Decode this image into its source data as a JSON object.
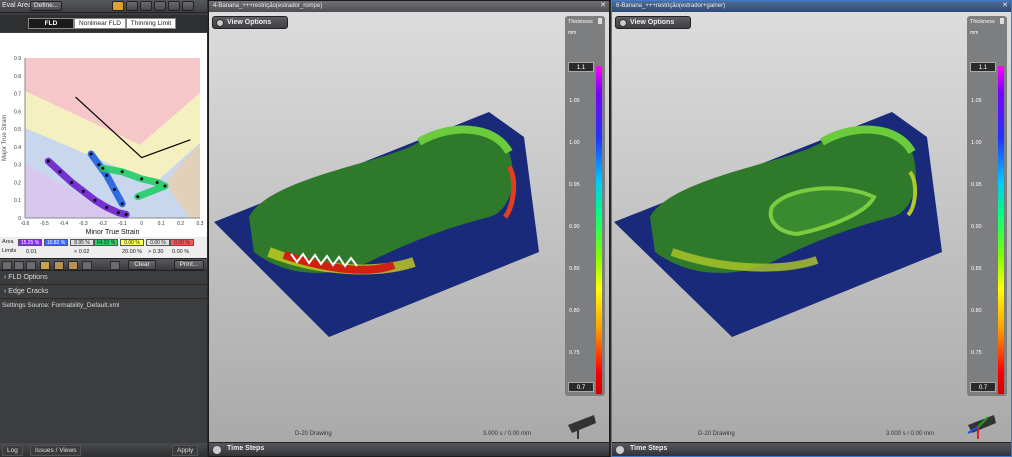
{
  "left": {
    "header": {
      "eval_area": "Eval Area",
      "define_btn": "Define..."
    },
    "tabs": [
      {
        "label": "FLD",
        "active": true
      },
      {
        "label": "Nonlinear FLD",
        "active": false
      },
      {
        "label": "Thinning Limit",
        "active": false
      }
    ],
    "chart_data": {
      "type": "scatter",
      "xlabel": "Minor True Strain",
      "ylabel": "Major True Strain",
      "xlim": [
        -0.6,
        0.3
      ],
      "ylim": [
        0,
        0.9
      ],
      "x_ticks": [
        "-0.6",
        "-0.5",
        "-0.4",
        "-0.3",
        "-0.2",
        "-0.1",
        "0",
        "0.1",
        "0.2",
        "0.3"
      ],
      "y_ticks": [
        "0",
        "0.1",
        "0.2",
        "0.3",
        "0.4",
        "0.5",
        "0.6",
        "0.7",
        "0.8",
        "0.9"
      ],
      "series": [
        {
          "values": [
            [
              -0.48,
              0.32
            ],
            [
              -0.42,
              0.26
            ],
            [
              -0.36,
              0.2
            ],
            [
              -0.3,
              0.15
            ],
            [
              -0.24,
              0.1
            ],
            [
              -0.18,
              0.06
            ],
            [
              -0.12,
              0.03
            ],
            [
              -0.08,
              0.02
            ]
          ]
        },
        {
          "values": [
            [
              -0.26,
              0.36
            ],
            [
              -0.22,
              0.3
            ],
            [
              -0.18,
              0.24
            ],
            [
              -0.14,
              0.16
            ],
            [
              -0.1,
              0.08
            ]
          ]
        },
        {
          "values": [
            [
              -0.2,
              0.28
            ],
            [
              -0.1,
              0.26
            ],
            [
              0,
              0.22
            ],
            [
              0.08,
              0.2
            ],
            [
              0.12,
              0.18
            ],
            [
              -0.02,
              0.12
            ]
          ]
        }
      ],
      "flc": [
        [
          -0.34,
          0.68
        ],
        [
          0,
          0.34
        ],
        [
          0.25,
          0.44
        ]
      ]
    },
    "legend": {
      "area_label": "Area",
      "limits_label": "Limits",
      "values": [
        {
          "text": "15.25 %",
          "color": "#8a2be2"
        },
        {
          "text": "10.82 %",
          "color": "#3a6bff"
        },
        {
          "text": "8.95 %",
          "color": "#e0e0e0"
        },
        {
          "text": "64.92 %",
          "color": "#33cc66"
        },
        {
          "text": "0.00 %",
          "color": "#ffff66"
        },
        {
          "text": "0.00 %",
          "color": "#e0e0e0"
        },
        {
          "text": "0.00 %",
          "color": "#ff5555"
        }
      ],
      "limits": [
        "0.01",
        "< 0.02",
        "20.00 %",
        "> 0.30",
        "0.00 %"
      ]
    },
    "toolbar": {
      "clear": "Clear",
      "print": "Print..."
    },
    "sections": [
      "FLD Options",
      "Edge Cracks"
    ],
    "settings_source": "Settings Source:  Formability_Default.xml",
    "bottom_tabs": [
      "Log",
      "Issues / Views"
    ],
    "apply": "Apply"
  },
  "viewports": [
    {
      "title": "4-Banana_+++restrição(estrador_rompe)",
      "view_options": "View Options",
      "colorbar": {
        "title": "Thickness",
        "unit": "mm",
        "max": "1.1",
        "min": "0.7",
        "ticks": [
          "1.05",
          "1.00",
          "0.95",
          "0.90",
          "0.85",
          "0.80",
          "0.75"
        ]
      },
      "time_steps": "Time Steps",
      "drawing": "D-20 Drawing",
      "time": "3.000 s / 0.00 mm"
    },
    {
      "title": "6-Banana_+++restrição(estrador+gainer)",
      "view_options": "View Options",
      "colorbar": {
        "title": "Thickness",
        "unit": "mm",
        "max": "1.1",
        "min": "0.7",
        "ticks": [
          "1.05",
          "1.00",
          "0.95",
          "0.90",
          "0.85",
          "0.80",
          "0.75"
        ]
      },
      "time_steps": "Time Steps",
      "drawing": "D-20 Drawing",
      "time": "3.000 s / 0.00 mm"
    }
  ]
}
